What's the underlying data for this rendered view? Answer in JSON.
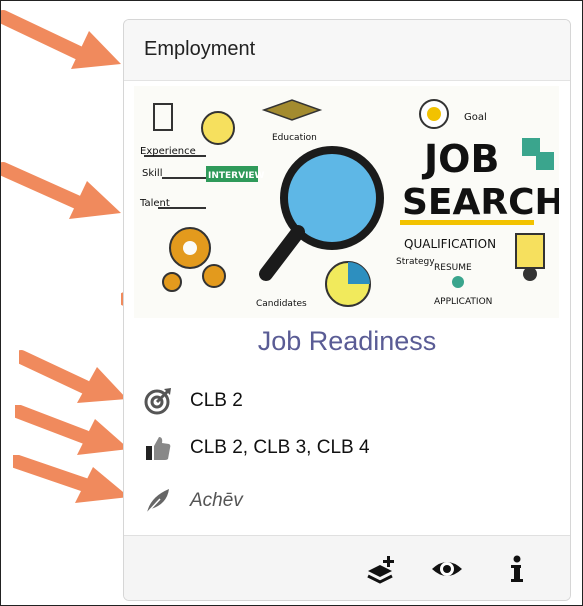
{
  "card": {
    "header_title": "Employment",
    "course_title": "Job Readiness",
    "rows": [
      {
        "icon": "target-icon",
        "text": "CLB 2"
      },
      {
        "icon": "thumbs-up-icon",
        "text": "CLB 2, CLB 3, CLB 4"
      },
      {
        "icon": "feather-icon",
        "text": "Achēv"
      }
    ],
    "footer_actions": [
      {
        "icon": "add-layers-icon"
      },
      {
        "icon": "eye-icon"
      },
      {
        "icon": "info-icon"
      }
    ]
  },
  "banner": {
    "big_text_1": "JOB",
    "big_text_2": "SEARCH",
    "labels": [
      "Experience",
      "Skill",
      "Talent",
      "INTERVIEW",
      "Education",
      "Goal",
      "QUALIFICATION",
      "RESUME",
      "APPLICATION",
      "Candidates",
      "Strategy"
    ]
  },
  "colors": {
    "arrow": "#f08a5d",
    "course_title": "#5a5c95",
    "icon_gray": "#555555",
    "magnifier_lens": "#5eb7e6"
  }
}
